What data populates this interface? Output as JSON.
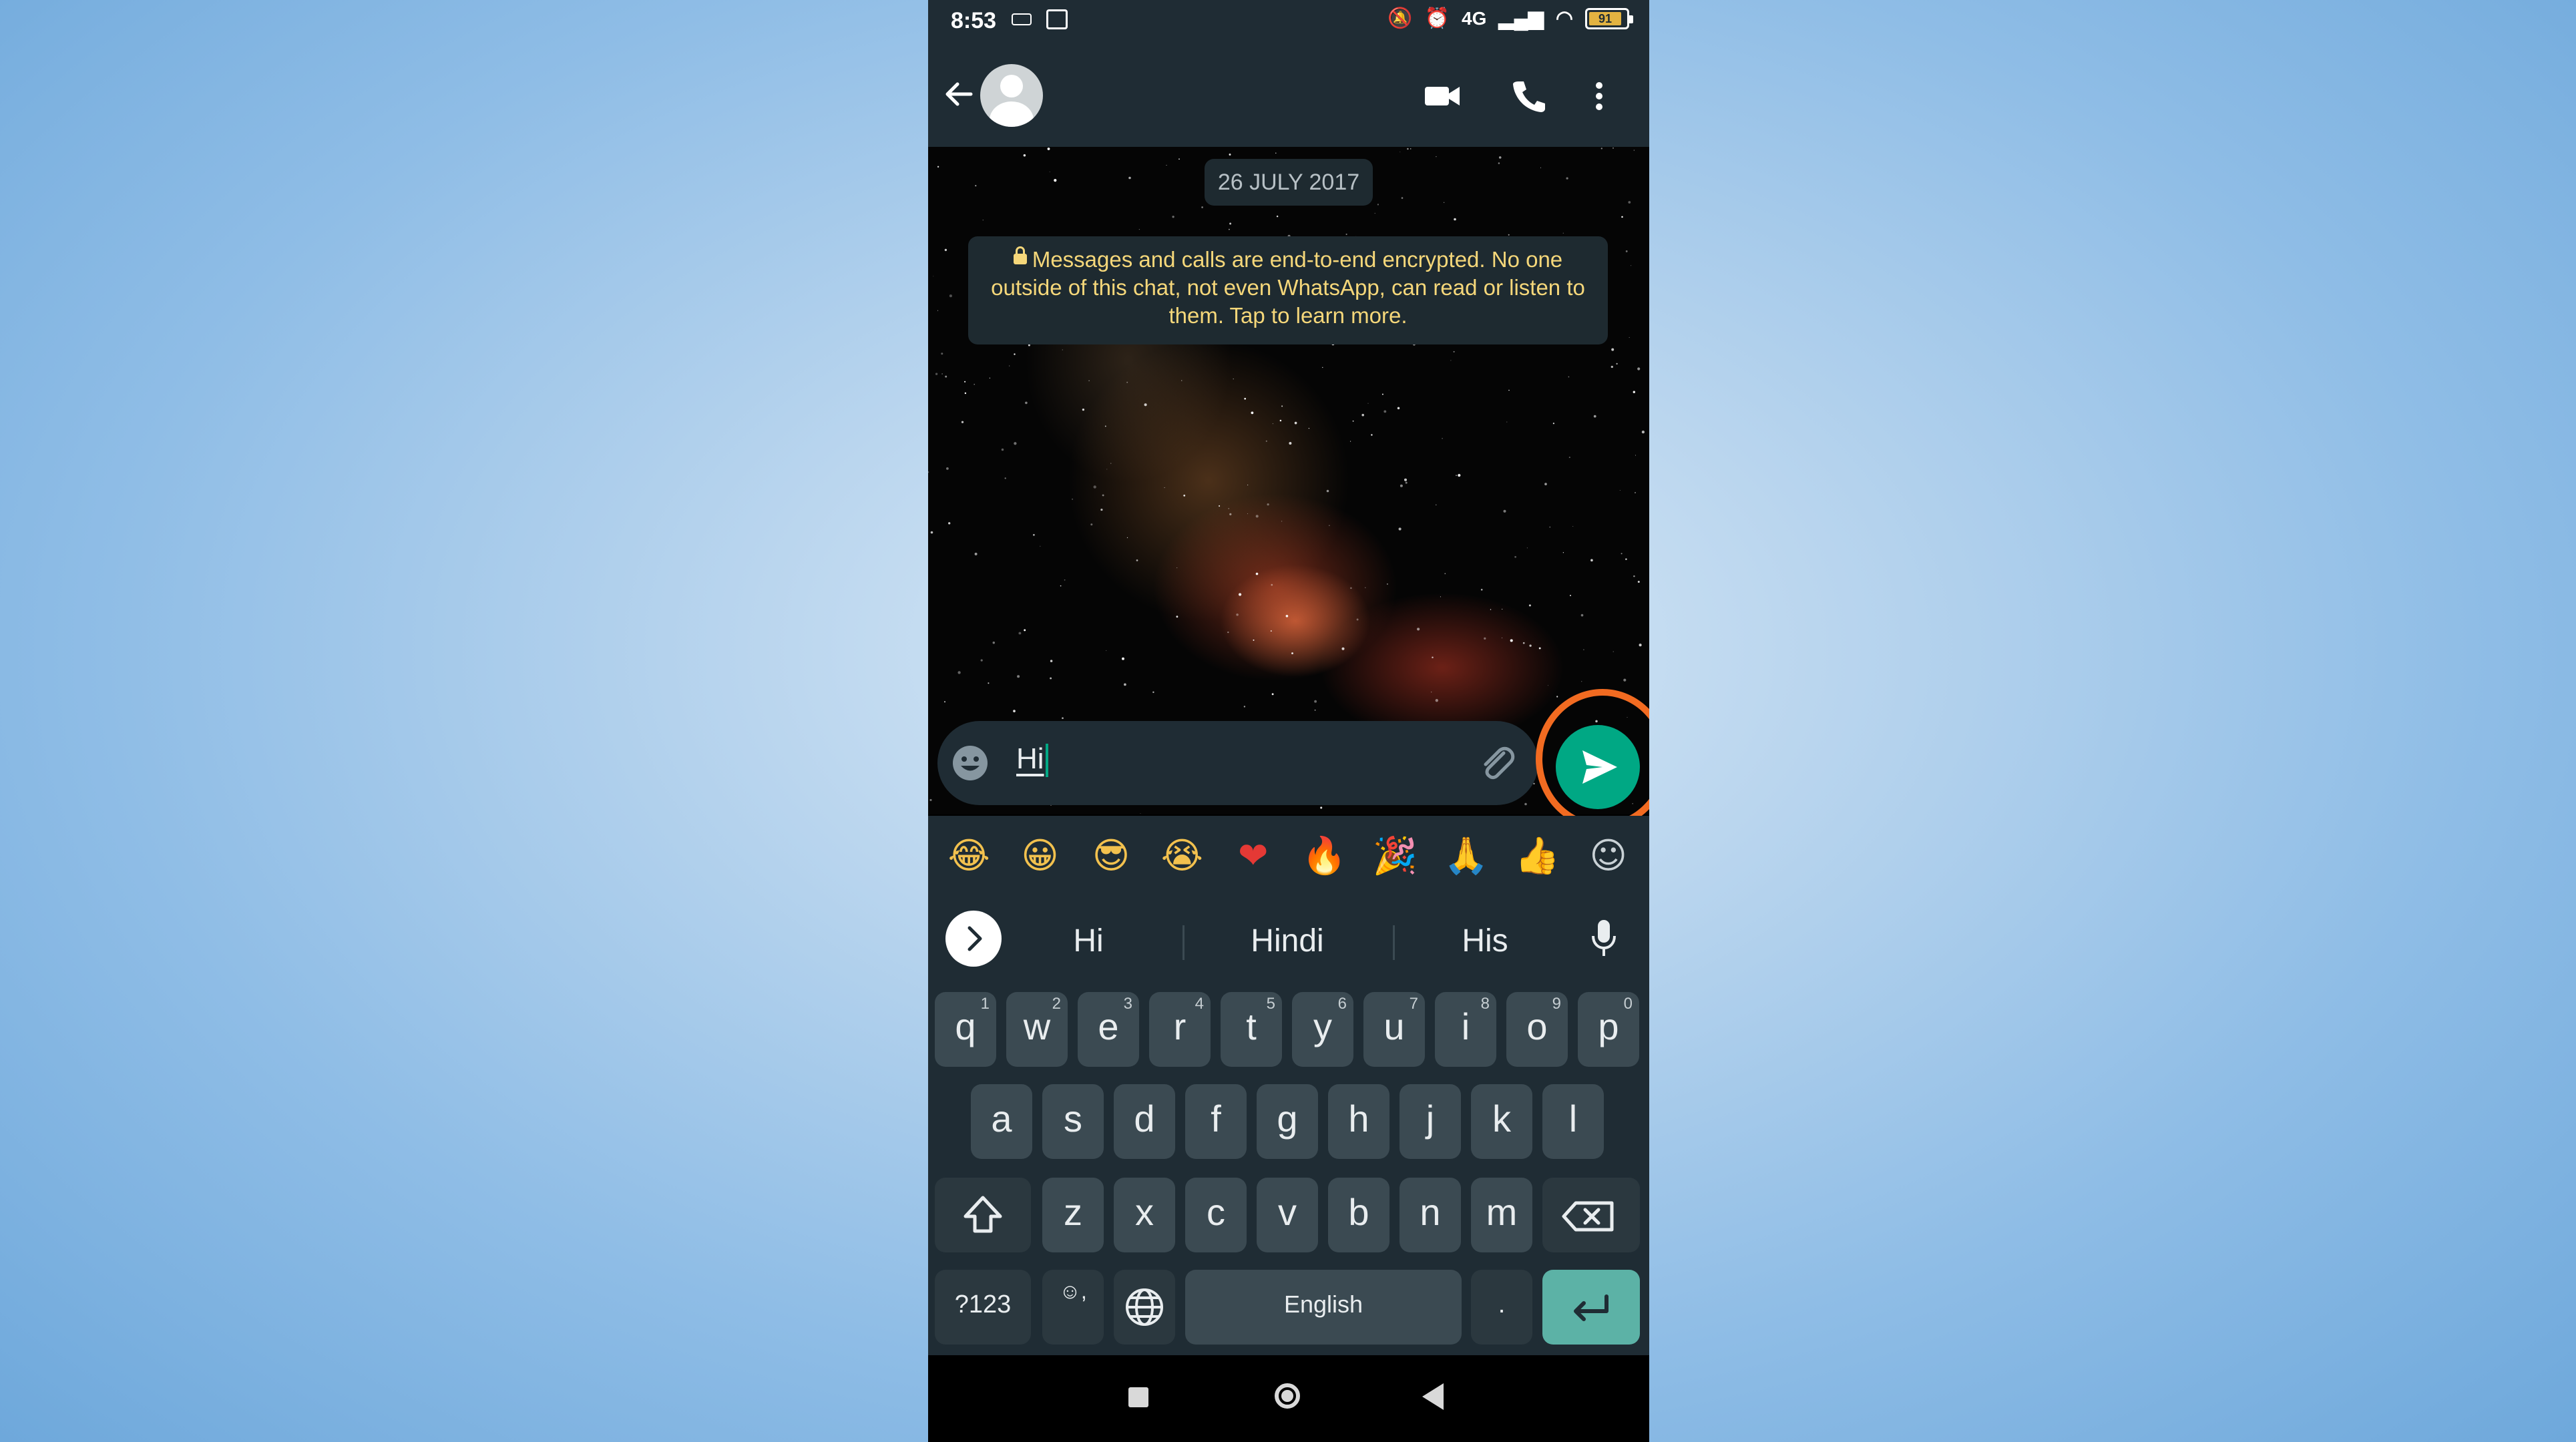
{
  "status_bar": {
    "time": "8:53",
    "network_label": "4G",
    "battery_level": "91"
  },
  "header": {
    "icons": [
      "back-arrow-icon",
      "avatar",
      "video-call-icon",
      "voice-call-icon",
      "more-options-icon"
    ]
  },
  "chat": {
    "date_chip": "26 JULY 2017",
    "encryption_notice": "Messages and calls are end-to-end encrypted. No one outside of this chat, not even WhatsApp, can read or listen to them. Tap to learn more."
  },
  "composer": {
    "text": "Hi",
    "send_highlight_color": "#f26b21",
    "send_color": "#00a884"
  },
  "emoji_strip": [
    "😂",
    "😀",
    "😎",
    "😭",
    "❤",
    "🔥",
    "🎉",
    "🙏",
    "👍",
    "☺"
  ],
  "suggestions": [
    "Hi",
    "Hindi",
    "His"
  ],
  "keyboard": {
    "row1": [
      {
        "k": "q",
        "h": "1"
      },
      {
        "k": "w",
        "h": "2"
      },
      {
        "k": "e",
        "h": "3"
      },
      {
        "k": "r",
        "h": "4"
      },
      {
        "k": "t",
        "h": "5"
      },
      {
        "k": "y",
        "h": "6"
      },
      {
        "k": "u",
        "h": "7"
      },
      {
        "k": "i",
        "h": "8"
      },
      {
        "k": "o",
        "h": "9"
      },
      {
        "k": "p",
        "h": "0"
      }
    ],
    "row2": [
      "a",
      "s",
      "d",
      "f",
      "g",
      "h",
      "j",
      "k",
      "l"
    ],
    "row3": [
      "z",
      "x",
      "c",
      "v",
      "b",
      "n",
      "m"
    ],
    "symbols_label": "?123",
    "emoji_comma_label": "☺,",
    "space_label": "English",
    "period_label": "."
  }
}
